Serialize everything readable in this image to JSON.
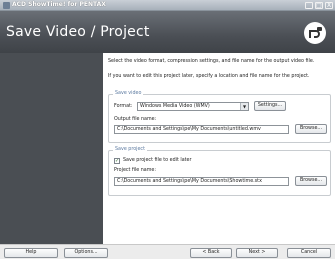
{
  "window": {
    "title": "ACD ShowTime! for PENTAX",
    "minimize": "_",
    "maximize": "□",
    "close": "X"
  },
  "header": {
    "title": "Save Video / Project",
    "logo_icon": "pentax-logo-icon"
  },
  "intro": {
    "line1": "Select the video format, compression settings, and file name for the output video file.",
    "line2": "If you want to edit this project later, specify a location and file name for the project."
  },
  "save_video": {
    "legend": "Save video",
    "format_label": "Format:",
    "format_value": "Windows Media Video (WMV)",
    "settings_button": "Settings...",
    "output_label": "Output file name:",
    "output_value": "C:\\Documents and Settings\\pe\\My Documents\\untitled.wmv",
    "browse_button": "Browse..."
  },
  "save_project": {
    "legend": "Save project",
    "checkbox_label": "Save project file to edit later",
    "checkbox_checked": true,
    "checkmark": "✓",
    "project_label": "Project file name:",
    "project_value": "C:\\Documents and Settings\\pe\\My Documents\\Showtime.stx",
    "browse_button": "Browse..."
  },
  "bottom": {
    "help": "Help",
    "options": "Options...",
    "back": "< Back",
    "next": "Next >",
    "cancel": "Cancel"
  }
}
